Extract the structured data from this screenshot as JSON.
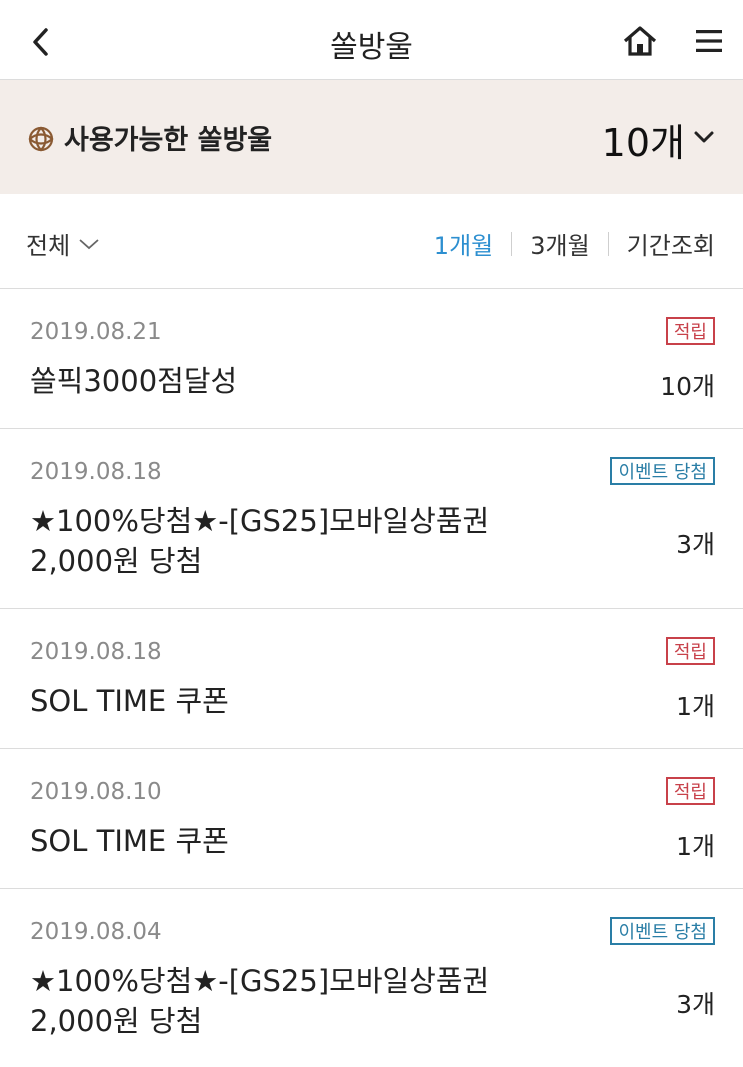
{
  "header": {
    "title": "쏠방울"
  },
  "summary": {
    "label": "사용가능한 쏠방울",
    "count": "10개"
  },
  "filter": {
    "all_label": "전체",
    "periods": [
      "1개월",
      "3개월",
      "기간조회"
    ],
    "active_period": "1개월"
  },
  "items": [
    {
      "date": "2019.08.21",
      "badge": "적립",
      "badge_type": "earn",
      "name": "쏠픽3000점달성",
      "qty": "10개"
    },
    {
      "date": "2019.08.18",
      "badge": "이벤트 당첨",
      "badge_type": "event",
      "name": "★100%당첨★-[GS25]모바일상품권 2,000원 당첨",
      "qty": "3개"
    },
    {
      "date": "2019.08.18",
      "badge": "적립",
      "badge_type": "earn",
      "name": "SOL TIME 쿠폰",
      "qty": "1개"
    },
    {
      "date": "2019.08.10",
      "badge": "적립",
      "badge_type": "earn",
      "name": "SOL TIME 쿠폰",
      "qty": "1개"
    },
    {
      "date": "2019.08.04",
      "badge": "이벤트 당첨",
      "badge_type": "event",
      "name": "★100%당첨★-[GS25]모바일상품권 2,000원 당첨",
      "qty": "3개"
    }
  ],
  "colors": {
    "accent": "#2d8fd0",
    "earn_badge": "#c8414a",
    "event_badge": "#2a7ea6",
    "summary_bg": "#f3ede9"
  },
  "icons": [
    "back-icon",
    "home-icon",
    "menu-icon",
    "bell-icon",
    "chevron-down-icon"
  ]
}
